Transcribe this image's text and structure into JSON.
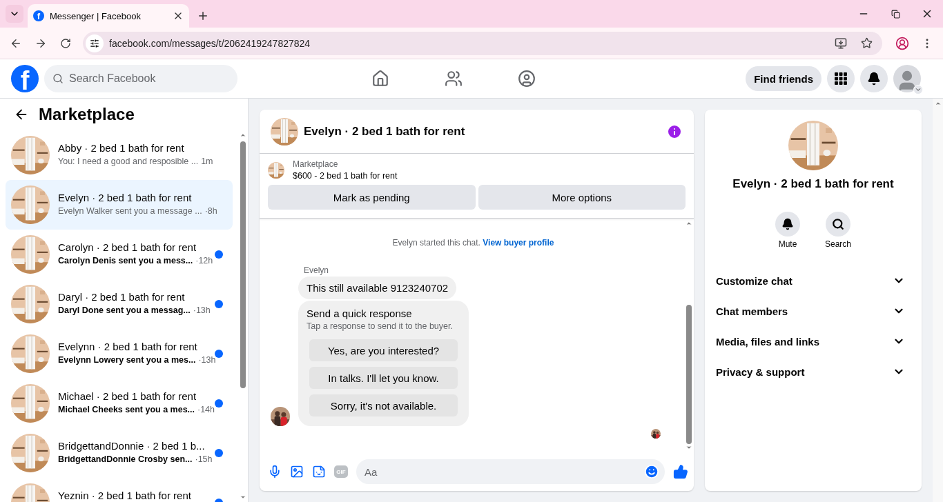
{
  "browser": {
    "favicon_letter": "f",
    "tab_title": "Messenger | Facebook",
    "url": "facebook.com/messages/t/2062419247827824"
  },
  "header": {
    "logo_letter": "f",
    "search": {
      "placeholder": "Search Facebook"
    },
    "find_friends": "Find friends"
  },
  "sidebar": {
    "title": "Marketplace",
    "conversations": [
      {
        "name": "Abby · 2 bed 1 bath for rent",
        "preview": "You: I need a good and resposible ...",
        "time": "1m",
        "unread": false,
        "selected": false
      },
      {
        "name": "Evelyn · 2 bed 1 bath for rent",
        "preview": "Evelyn Walker sent you a message ...",
        "time": "·8h",
        "unread": false,
        "selected": true
      },
      {
        "name": "Carolyn · 2 bed 1 bath for rent",
        "preview": "Carolyn Denis sent you a mess...",
        "time": "·12h",
        "unread": true,
        "selected": false
      },
      {
        "name": "Daryl · 2 bed 1 bath for rent",
        "preview": "Daryl Done sent you a messag...",
        "time": "·13h",
        "unread": true,
        "selected": false
      },
      {
        "name": "Evelynn · 2 bed 1 bath for rent",
        "preview": "Evelynn Lowery sent you a mes...",
        "time": "·13h",
        "unread": true,
        "selected": false
      },
      {
        "name": "Michael · 2 bed 1 bath for rent",
        "preview": "Michael Cheeks sent you a mes...",
        "time": "·14h",
        "unread": true,
        "selected": false
      },
      {
        "name": "BridgettandDonnie · 2 bed 1 b...",
        "preview": "BridgettandDonnie Crosby sen...",
        "time": "·15h",
        "unread": true,
        "selected": false
      },
      {
        "name": "Yeznin · 2 bed 1 bath for rent",
        "unread": true,
        "selected": false
      }
    ]
  },
  "chat": {
    "title": "Evelyn · 2 bed 1 bath for rent",
    "listing": {
      "label": "Marketplace",
      "item": "$600 - 2 bed 1 bath for rent"
    },
    "actions": [
      "Mark as pending",
      "More options"
    ],
    "notice": {
      "text": "Evelyn started this chat.",
      "link": "View buyer profile"
    },
    "message": {
      "sender": "Evelyn",
      "text": "This still available 9123240702"
    },
    "quick_response": {
      "title": "Send a quick response",
      "hint": "Tap a response to send it to the buyer.",
      "options": [
        "Yes, are you interested?",
        "In talks. I'll let you know.",
        "Sorry, it's not available."
      ]
    },
    "composer": {
      "gif_label": "GIF",
      "placeholder": "Aa"
    }
  },
  "details": {
    "title": "Evelyn · 2 bed 1 bath for rent",
    "actions": [
      {
        "kind": "bell",
        "label": "Mute"
      },
      {
        "kind": "search",
        "label": "Search"
      }
    ],
    "sections": [
      {
        "label": "Customize chat",
        "expanded": false
      },
      {
        "label": "Chat members",
        "expanded": false
      },
      {
        "label": "Media, files and links",
        "expanded": false
      },
      {
        "label": "Privacy & support",
        "expanded": false
      }
    ]
  }
}
